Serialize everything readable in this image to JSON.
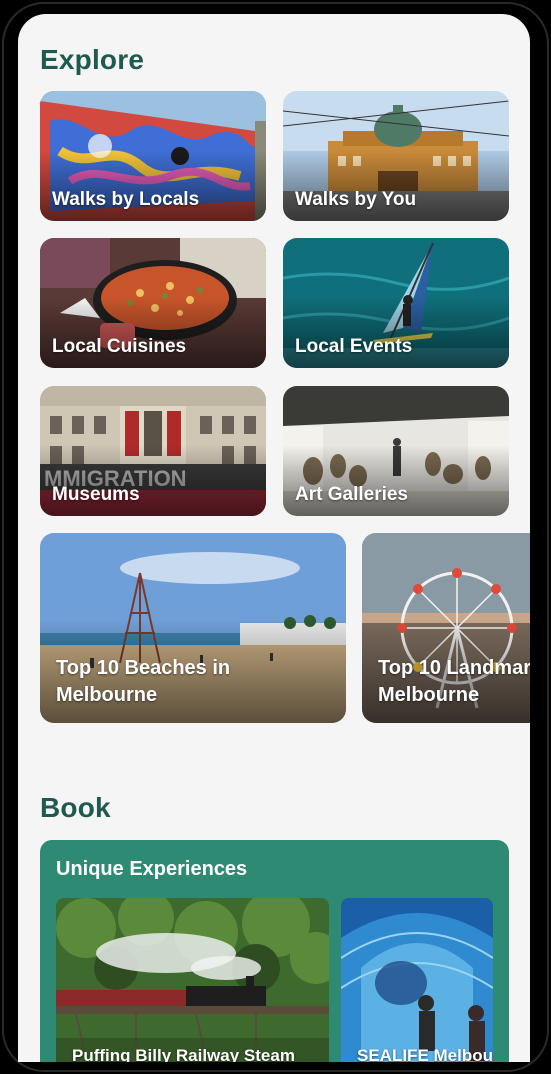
{
  "explore": {
    "title": "Explore",
    "tiles": [
      {
        "label": "Walks by Locals"
      },
      {
        "label": "Walks by You"
      },
      {
        "label": "Local Cuisines"
      },
      {
        "label": "Local Events"
      },
      {
        "label": "Museums"
      },
      {
        "label": "Art Galleries"
      }
    ],
    "featured": [
      {
        "label_line1": "Top 10 Beaches in",
        "label_line2": "Melbourne"
      },
      {
        "label_line1": "Top 10 Landmar",
        "label_line2": "Melbourne"
      }
    ]
  },
  "book": {
    "title": "Book",
    "card": {
      "heading": "Unique Experiences",
      "items": [
        {
          "label": "Puffing Billy Railway Steam"
        },
        {
          "label": "SEALIFE Melbou"
        }
      ]
    }
  },
  "colors": {
    "title": "#1e5a50",
    "book_card": "#2f8a73",
    "screen_bg": "#f5f5f5"
  }
}
